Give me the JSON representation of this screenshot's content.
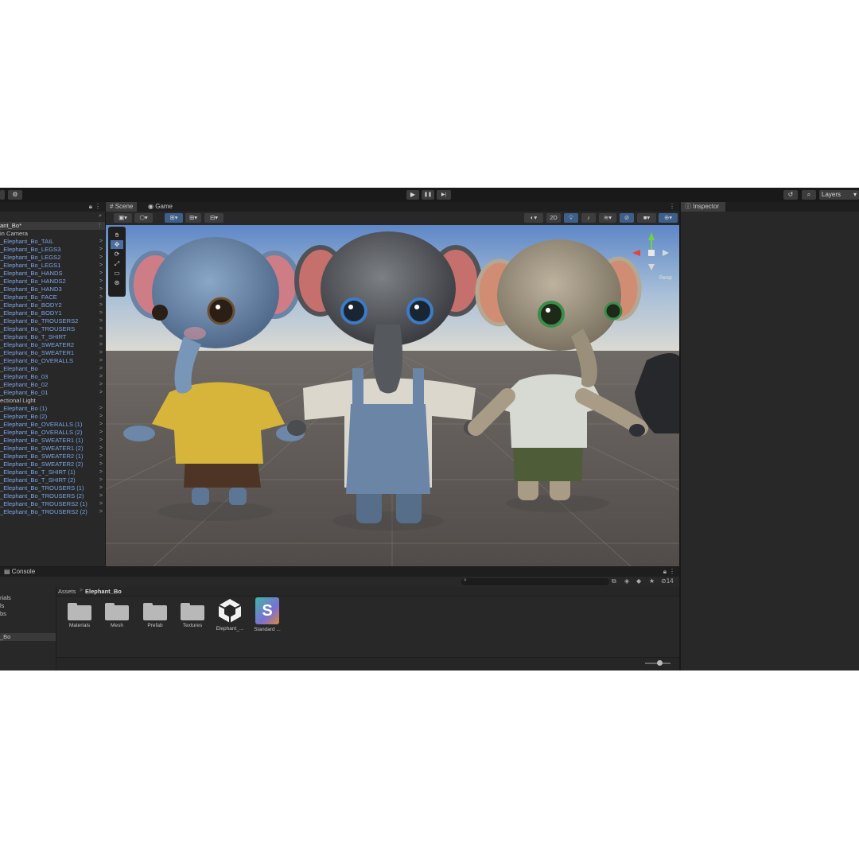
{
  "toolbar": {
    "play": "▶",
    "pause": "❚❚",
    "step": "▶|",
    "layers_label": "Layers"
  },
  "hierarchy": {
    "root": "ant_Bo*",
    "rows": [
      {
        "label": "in Camera",
        "style": "white",
        "arrow": ""
      },
      {
        "label": "_Elephant_Bo_TAIL",
        "style": "blue",
        "arrow": ">"
      },
      {
        "label": "_Elephant_Bo_LEGS3",
        "style": "blue",
        "arrow": ">"
      },
      {
        "label": "_Elephant_Bo_LEGS2",
        "style": "blue",
        "arrow": ">"
      },
      {
        "label": "_Elephant_Bo_LEGS1",
        "style": "blue",
        "arrow": ">"
      },
      {
        "label": "_Elephant_Bo_HANDS",
        "style": "blue",
        "arrow": ">"
      },
      {
        "label": "_Elephant_Bo_HANDS2",
        "style": "blue",
        "arrow": ">"
      },
      {
        "label": "_Elephant_Bo_HAND3",
        "style": "blue",
        "arrow": ">"
      },
      {
        "label": "_Elephant_Bo_FACE",
        "style": "blue",
        "arrow": ">"
      },
      {
        "label": "_Elephant_Bo_BODY2",
        "style": "blue",
        "arrow": ">"
      },
      {
        "label": "_Elephant_Bo_BODY1",
        "style": "blue",
        "arrow": ">"
      },
      {
        "label": "_Elephant_Bo_TROUSERS2",
        "style": "blue",
        "arrow": ">"
      },
      {
        "label": "_Elephant_Bo_TROUSERS",
        "style": "blue",
        "arrow": ">"
      },
      {
        "label": "_Elephant_Bo_T_SHIRT",
        "style": "blue",
        "arrow": ">"
      },
      {
        "label": "_Elephant_Bo_SWEATER2",
        "style": "blue",
        "arrow": ">"
      },
      {
        "label": "_Elephant_Bo_SWEATER1",
        "style": "blue",
        "arrow": ">"
      },
      {
        "label": "_Elephant_Bo_OVERALLS",
        "style": "blue",
        "arrow": ">"
      },
      {
        "label": "_Elephant_Bo",
        "style": "blue",
        "arrow": ">"
      },
      {
        "label": "_Elephant_Bo_03",
        "style": "blue",
        "arrow": ">"
      },
      {
        "label": "_Elephant_Bo_02",
        "style": "blue",
        "arrow": ">"
      },
      {
        "label": "_Elephant_Bo_01",
        "style": "blue",
        "arrow": ">"
      },
      {
        "label": "ectional Light",
        "style": "white",
        "arrow": ""
      },
      {
        "label": "_Elephant_Bo (1)",
        "style": "blue",
        "arrow": ">"
      },
      {
        "label": "_Elephant_Bo (2)",
        "style": "blue",
        "arrow": ">"
      },
      {
        "label": "_Elephant_Bo_OVERALLS (1)",
        "style": "blue",
        "arrow": ">"
      },
      {
        "label": "_Elephant_Bo_OVERALLS (2)",
        "style": "blue",
        "arrow": ">"
      },
      {
        "label": "_Elephant_Bo_SWEATER1 (1)",
        "style": "blue",
        "arrow": ">"
      },
      {
        "label": "_Elephant_Bo_SWEATER1 (2)",
        "style": "blue",
        "arrow": ">"
      },
      {
        "label": "_Elephant_Bo_SWEATER2 (1)",
        "style": "blue",
        "arrow": ">"
      },
      {
        "label": "_Elephant_Bo_SWEATER2 (2)",
        "style": "blue",
        "arrow": ">"
      },
      {
        "label": "_Elephant_Bo_T_SHIRT (1)",
        "style": "blue",
        "arrow": ">"
      },
      {
        "label": "_Elephant_Bo_T_SHIRT (2)",
        "style": "blue",
        "arrow": ">"
      },
      {
        "label": "_Elephant_Bo_TROUSERS (1)",
        "style": "blue",
        "arrow": ">"
      },
      {
        "label": "_Elephant_Bo_TROUSERS (2)",
        "style": "blue",
        "arrow": ">"
      },
      {
        "label": "_Elephant_Bo_TROUSERS2 (1)",
        "style": "blue",
        "arrow": ">"
      },
      {
        "label": "_Elephant_Bo_TROUSERS2 (2)",
        "style": "blue",
        "arrow": ">"
      }
    ]
  },
  "scene": {
    "tab_scene": "Scene",
    "tab_game": "Game",
    "btn_2d": "2D",
    "persp_label": "Persp"
  },
  "inspector": {
    "tab": "Inspector"
  },
  "bottom": {
    "tab_console": "Console",
    "hidden_count": "14",
    "breadcrumb_root": "Assets",
    "breadcrumb_sep": ">",
    "breadcrumb_current": "Elephant_Bo",
    "tree": [
      "rials",
      "ls",
      "bs",
      "_Bo"
    ],
    "assets": [
      {
        "label": "Materials",
        "kind": "folder"
      },
      {
        "label": "Mesh",
        "kind": "folder"
      },
      {
        "label": "Prefab",
        "kind": "folder"
      },
      {
        "label": "Textures",
        "kind": "folder"
      },
      {
        "label": "Elephant_...",
        "kind": "unity"
      },
      {
        "label": "Standard ...",
        "kind": "shader"
      }
    ]
  }
}
